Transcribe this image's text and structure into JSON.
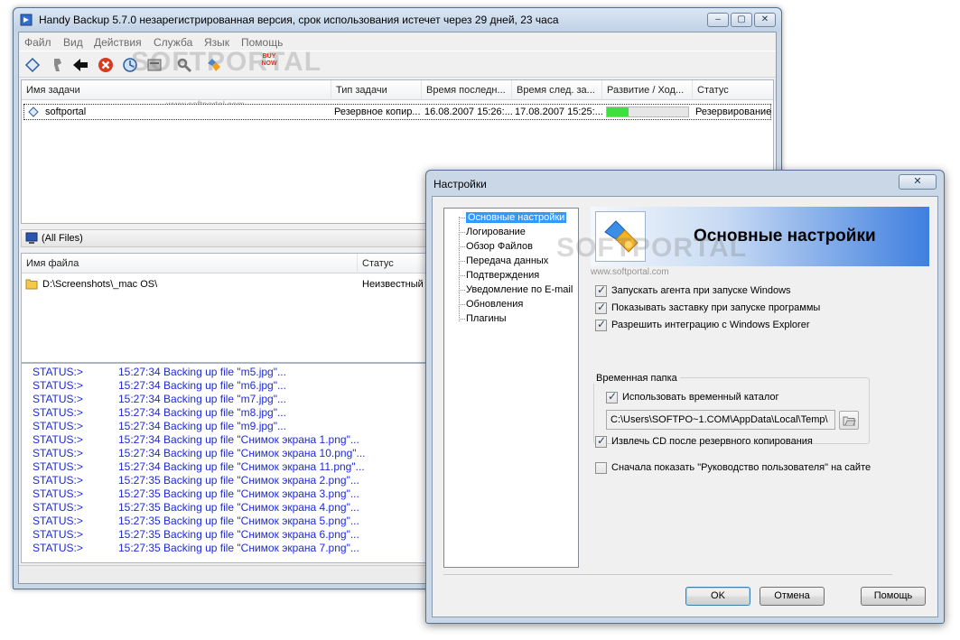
{
  "main_window": {
    "title": "Handy Backup 5.7.0 незарегистрированная версия, срок использования истечет через  29 дней, 23 часа",
    "caption_buttons": {
      "minimize": "‒",
      "maximize": "▢",
      "close": "✕"
    },
    "menu": [
      "Файл",
      "Вид",
      "Действия",
      "Служба",
      "Язык",
      "Помощь"
    ],
    "toolbar_icons": [
      "new-task-icon",
      "edit-icon",
      "back-arrow-icon",
      "stop-icon",
      "restore-icon",
      "properties-icon",
      "tools-icon",
      "buy-now-icon"
    ],
    "toolbar_buy_text": "BUY NOW",
    "watermark_big": "SOFTPORTAL",
    "watermark_small": "www.softportal.com",
    "tasks": {
      "columns": [
        "Имя задачи",
        "Тип задачи",
        "Время последн...",
        "Время след. за...",
        "Развитие / Ход...",
        "Статус"
      ],
      "rows": [
        {
          "name": "softportal",
          "type": "Резервное копир...",
          "last": "16.08.2007 15:26:...",
          "next": "17.08.2007 15:25:...",
          "progress": 0.27,
          "status": "Резервирование"
        }
      ]
    },
    "filter_label": "(All Files)",
    "files": {
      "columns": [
        "Имя файла",
        "Статус"
      ],
      "rows": [
        {
          "name": "D:\\Screenshots\\_mac OS\\",
          "status": "Неизвестный"
        }
      ]
    },
    "log": [
      {
        "status": "STATUS:>",
        "msg": "15:27:34 Backing up file \"m5.jpg\"..."
      },
      {
        "status": "STATUS:>",
        "msg": "15:27:34 Backing up file \"m6.jpg\"..."
      },
      {
        "status": "STATUS:>",
        "msg": "15:27:34 Backing up file \"m7.jpg\"..."
      },
      {
        "status": "STATUS:>",
        "msg": "15:27:34 Backing up file \"m8.jpg\"..."
      },
      {
        "status": "STATUS:>",
        "msg": "15:27:34 Backing up file \"m9.jpg\"..."
      },
      {
        "status": "STATUS:>",
        "msg": "15:27:34 Backing up file \"Снимок экрана 1.png\"..."
      },
      {
        "status": "STATUS:>",
        "msg": "15:27:34 Backing up file \"Снимок экрана 10.png\"..."
      },
      {
        "status": "STATUS:>",
        "msg": "15:27:34 Backing up file \"Снимок экрана 11.png\"..."
      },
      {
        "status": "STATUS:>",
        "msg": "15:27:35 Backing up file \"Снимок экрана 2.png\"..."
      },
      {
        "status": "STATUS:>",
        "msg": "15:27:35 Backing up file \"Снимок экрана 3.png\"..."
      },
      {
        "status": "STATUS:>",
        "msg": "15:27:35 Backing up file \"Снимок экрана 4.png\"..."
      },
      {
        "status": "STATUS:>",
        "msg": "15:27:35 Backing up file \"Снимок экрана 5.png\"..."
      },
      {
        "status": "STATUS:>",
        "msg": "15:27:35 Backing up file \"Снимок экрана 6.png\"..."
      },
      {
        "status": "STATUS:>",
        "msg": "15:27:35 Backing up file \"Снимок экрана 7.png\"..."
      }
    ]
  },
  "settings_dialog": {
    "title": "Настройки",
    "close": "✕",
    "tree": [
      "Основные настройки",
      "Логирование",
      "Обзор Файлов",
      "Передача данных",
      "Подтверждения",
      "Уведомление по E-mail",
      "Обновления",
      "Плагины"
    ],
    "selected_index": 0,
    "banner_title": "Основные настройки",
    "options": [
      {
        "label": "Запускать агента при запуске Windows",
        "checked": true
      },
      {
        "label": "Показывать заставку при запуске программы",
        "checked": true
      },
      {
        "label": "Разрешить интеграцию с Windows Explorer",
        "checked": true
      }
    ],
    "temp_group": {
      "label": "Временная папка",
      "use_temp_label": "Использовать временный каталог",
      "use_temp_checked": true,
      "path": "C:\\Users\\SOFTPO~1.COM\\AppData\\Local\\Temp\\"
    },
    "eject_cd": {
      "label": "Извлечь CD после резервного копирования",
      "checked": true
    },
    "show_guide": {
      "label": "Сначала показать \"Руководство пользователя\" на сайте",
      "checked": false
    },
    "buttons": {
      "ok": "OK",
      "cancel": "Отмена",
      "help": "Помощь"
    }
  },
  "colors": {
    "log_text": "#1d2ad8",
    "progress": "#3ee03e",
    "selection": "#3399ff"
  }
}
